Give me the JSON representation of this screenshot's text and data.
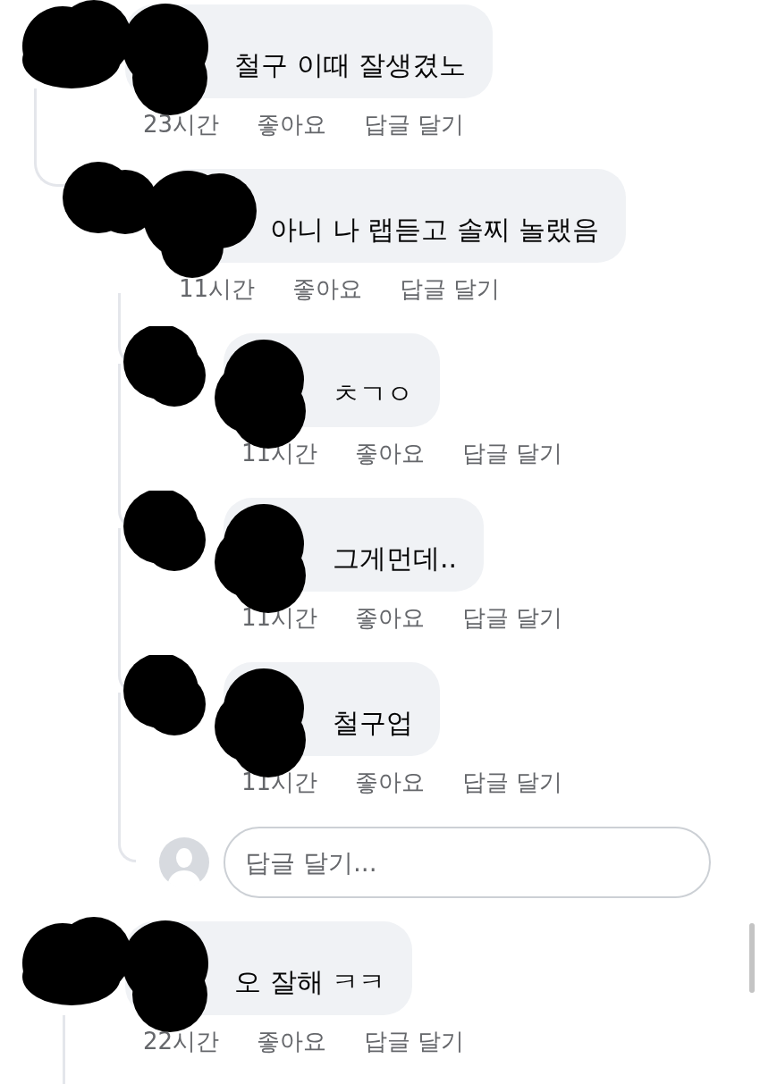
{
  "comments": [
    {
      "text": "철구 이때 잘생겼노",
      "time": "23시간",
      "like": "좋아요",
      "reply": "답글 달기",
      "replies": [
        {
          "text": "아니 나 랩듣고 솔찌 놀랬음",
          "time": "11시간",
          "like": "좋아요",
          "reply": "답글 달기",
          "replies": [
            {
              "text": "ㅊㄱㅇ",
              "time": "11시간",
              "like": "좋아요",
              "reply": "답글 달기"
            },
            {
              "text": "그게먼데..",
              "time": "11시간",
              "like": "좋아요",
              "reply": "답글 달기"
            },
            {
              "text": "철구업",
              "time": "11시간",
              "like": "좋아요",
              "reply": "답글 달기"
            }
          ],
          "reply_field": {
            "placeholder": "답글 달기..."
          }
        }
      ]
    },
    {
      "text": "오 잘해 ㅋㅋ",
      "time": "22시간",
      "like": "좋아요",
      "reply": "답글 달기"
    }
  ]
}
